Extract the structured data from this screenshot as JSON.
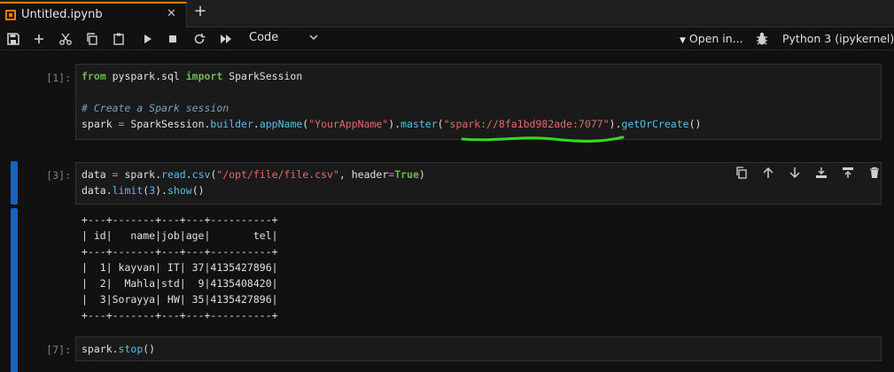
{
  "tab": {
    "title": "Untitled.ipynb",
    "close": "✕",
    "add": "+"
  },
  "toolbar": {
    "icons": [
      "save-icon",
      "add-icon",
      "cut-icon",
      "copy-icon",
      "paste-icon",
      "run-icon",
      "stop-icon",
      "restart-icon",
      "run-all-icon"
    ],
    "cell_type": "Code",
    "open_in": "Open in...",
    "kernel": "Python 3 (ipykernel)"
  },
  "cells": [
    {
      "prompt": "[1]:",
      "lines": [
        [
          [
            "kw",
            "from"
          ],
          [
            "id",
            " pyspark.sql "
          ],
          [
            "kw",
            "import"
          ],
          [
            "id",
            " SparkSession"
          ]
        ],
        [],
        [
          [
            "cm",
            "# Create a Spark session"
          ]
        ],
        [
          [
            "id",
            "spark "
          ],
          [
            "op",
            "="
          ],
          [
            "id",
            " SparkSession."
          ],
          [
            "fn",
            "builder"
          ],
          [
            "id",
            "."
          ],
          [
            "fn",
            "appName"
          ],
          [
            "id",
            "("
          ],
          [
            "str",
            "\"YourAppName\""
          ],
          [
            "id",
            ")."
          ],
          [
            "fn",
            "master"
          ],
          [
            "id",
            "("
          ],
          [
            "str",
            "\"spark://8fa1bd982ade:7077\""
          ],
          [
            "id",
            ")."
          ],
          [
            "fn",
            "getOrCreate"
          ],
          [
            "id",
            "()"
          ]
        ]
      ]
    },
    {
      "prompt": "[3]:",
      "lines": [
        [
          [
            "id",
            "data "
          ],
          [
            "op",
            "="
          ],
          [
            "id",
            " spark."
          ],
          [
            "fn",
            "read"
          ],
          [
            "id",
            "."
          ],
          [
            "fn",
            "csv"
          ],
          [
            "id",
            "("
          ],
          [
            "str",
            "\"/opt/file/file.csv\""
          ],
          [
            "id",
            ", header"
          ],
          [
            "op",
            "="
          ],
          [
            "kw",
            "True"
          ],
          [
            "id",
            ")"
          ]
        ],
        [
          [
            "id",
            "data."
          ],
          [
            "fn",
            "limit"
          ],
          [
            "id",
            "("
          ],
          [
            "fn",
            "3"
          ],
          [
            "id",
            ")."
          ],
          [
            "fn",
            "show"
          ],
          [
            "id",
            "()"
          ]
        ]
      ],
      "tools": [
        "duplicate-icon",
        "move-up-icon",
        "move-down-icon",
        "insert-above-icon",
        "insert-below-icon",
        "delete-icon"
      ],
      "output": "+---+-------+---+---+----------+\n| id|   name|job|age|       tel|\n+---+-------+---+---+----------+\n|  1| kayvan| IT| 37|4135427896|\n|  2|  Mahla|std|  9|4135408420|\n|  3|Sorayya| HW| 35|4135427896|\n+---+-------+---+---+----------+"
    },
    {
      "prompt": "[7]:",
      "lines": [
        [
          [
            "id",
            "spark."
          ],
          [
            "fn",
            "stop"
          ],
          [
            "id",
            "()"
          ]
        ]
      ]
    }
  ],
  "colors": {
    "accent": "#f57c00",
    "active_cell": "#1565c0",
    "annotation": "#39d62a"
  }
}
